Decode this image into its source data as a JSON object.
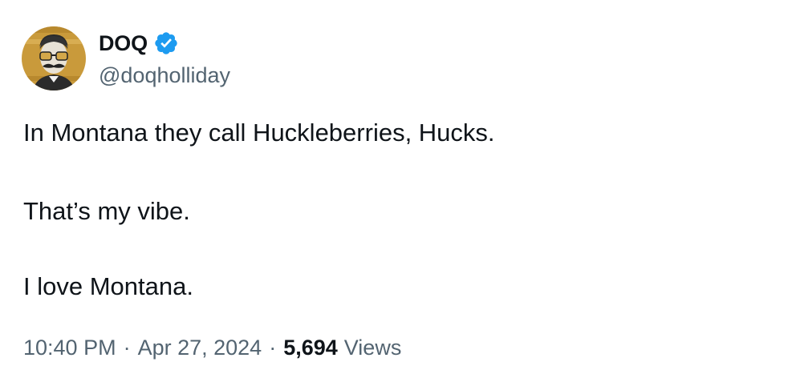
{
  "author": {
    "display_name": "DOQ",
    "handle": "@doqholliday",
    "verified": true,
    "avatar_icon": "mustache-man-sunglasses-avatar"
  },
  "tweet": {
    "lines": [
      "In Montana they call Huckleberries, Hucks.",
      "That’s my vibe.",
      "I love Montana."
    ]
  },
  "meta": {
    "time": "10:40 PM",
    "date": "Apr 27, 2024",
    "separator": "·",
    "views_count": "5,694",
    "views_label": "Views"
  },
  "colors": {
    "text_primary": "#0f1419",
    "text_secondary": "#536471",
    "verified_blue": "#1d9bf0",
    "avatar_background": "#c99a3b"
  }
}
